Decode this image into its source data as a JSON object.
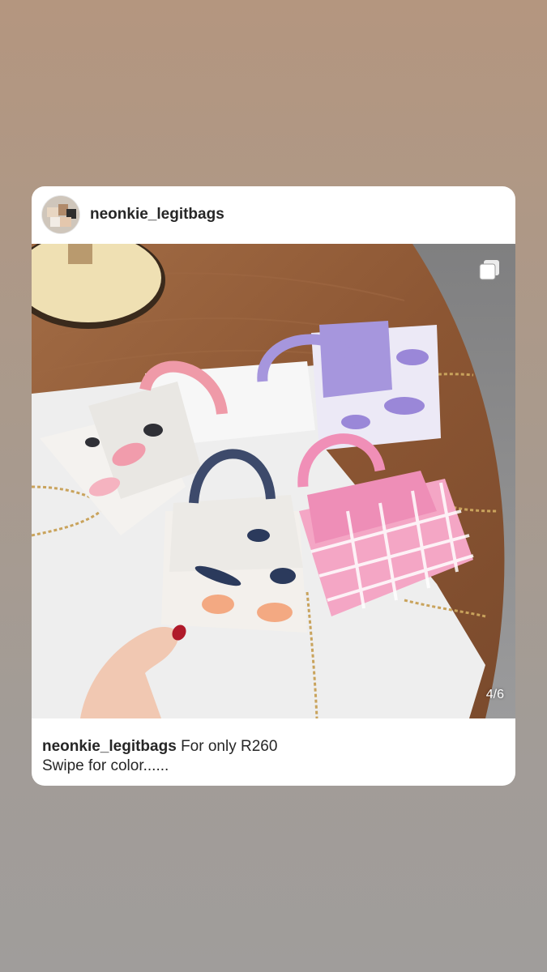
{
  "post": {
    "username": "neonkie_legitbags",
    "caption_user": "neonkie_legitbags",
    "caption_line1": "For only R260",
    "caption_line2": "Swipe for color......",
    "slide_counter": "4/6",
    "current_slide": 4,
    "total_slides": 6
  },
  "icons": {
    "avatar": "profile-avatar",
    "carousel": "multiple-photos-icon"
  }
}
